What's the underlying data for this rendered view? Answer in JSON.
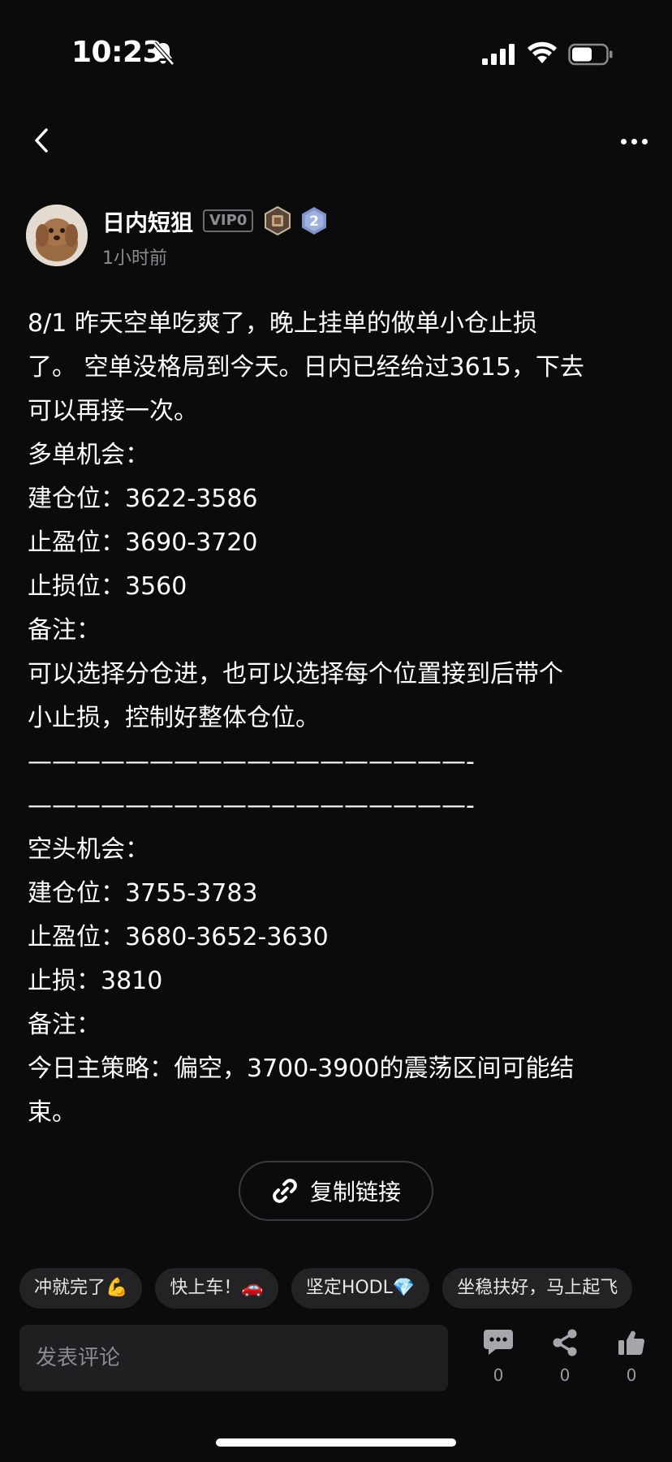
{
  "status_bar": {
    "time": "10:23",
    "battery_level": 0.6
  },
  "author": {
    "name": "日内短狙",
    "vip_label": "VIP0",
    "level": "2",
    "time_ago": "1小时前"
  },
  "post": {
    "lines": [
      "8/1  昨天空单吃爽了，晚上挂单的做单小仓止损",
      "了。 空单没格局到今天。日内已经给过3615，下去",
      "可以再接一次。",
      "多单机会：",
      "建仓位：3622-3586",
      "止盈位：3690-3720",
      "止损位：3560",
      "备注：",
      "可以选择分仓进，也可以选择每个位置接到后带个",
      "小止损，控制好整体仓位。",
      "——————————————————-",
      "——————————————————-",
      "空头机会：",
      "建仓位：3755-3783",
      "止盈位：3680-3652-3630",
      "止损：3810",
      "备注：",
      "今日主策略：偏空，3700-3900的震荡区间可能结",
      "束。"
    ]
  },
  "copy_link": {
    "label": "复制链接"
  },
  "quick_replies": [
    "冲就完了💪",
    "快上车！🚗",
    "坚定HODL💎",
    "坐稳扶好，马上起飞"
  ],
  "comment": {
    "placeholder": "发表评论"
  },
  "actions": {
    "comments": {
      "count": "0"
    },
    "shares": {
      "count": "0"
    },
    "likes": {
      "count": "0"
    }
  }
}
